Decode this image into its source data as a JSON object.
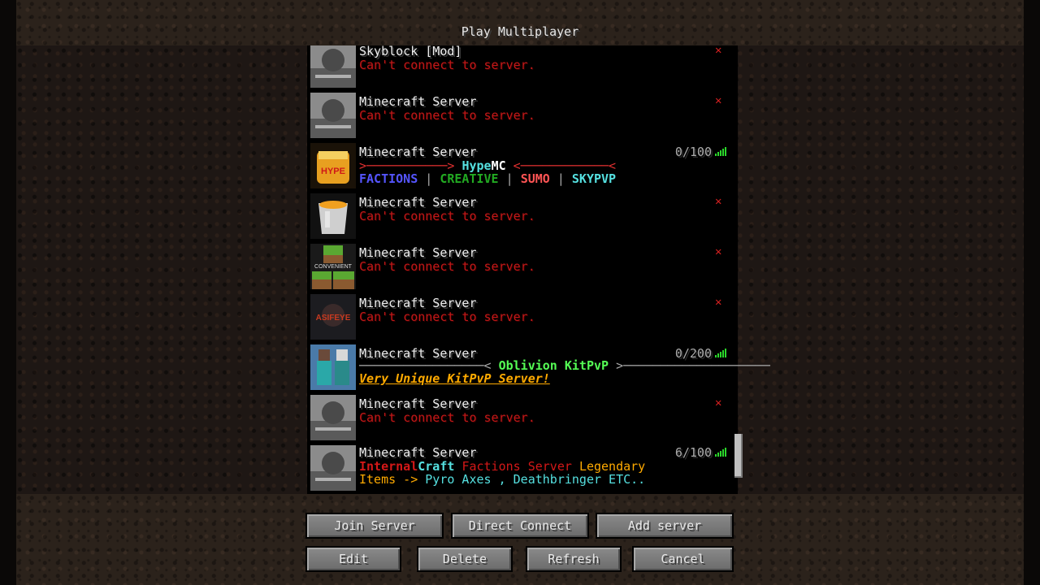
{
  "window": {
    "title": "Play Multiplayer"
  },
  "servers": [
    {
      "name": "Skyblock [Mod]",
      "status": "Can't connect to server.",
      "icon": "stone-pack-icon"
    },
    {
      "name": "Minecraft Server",
      "status": "Can't connect to server.",
      "icon": "stone-pack-icon"
    },
    {
      "name": "Minecraft Server",
      "players": "0/100",
      "icon": "hypemc-bucket-icon",
      "motd1": {
        "left": ">───────────>",
        "brand1": "Hype",
        "brand2": "MC",
        "right": "<────────────<"
      },
      "motd2": [
        "FACTIONS",
        "|",
        "CREATIVE",
        "|",
        "SUMO",
        "|",
        "SKYPVP"
      ]
    },
    {
      "name": "Minecraft Server",
      "status": "Can't connect to server.",
      "icon": "bucket-icon"
    },
    {
      "name": "Minecraft Server",
      "status": "Can't connect to server.",
      "icon": "grass-block-icon",
      "icon_text": "CONVENIENT"
    },
    {
      "name": "Minecraft Server",
      "status": "Can't connect to server.",
      "icon": "asifeye-icon",
      "icon_text": "ASIFEYE"
    },
    {
      "name": "Minecraft Server",
      "players": "0/200",
      "icon": "players-icon",
      "motd1": {
        "line_left": "─────────────────<",
        "title": "Oblivion KitPvP",
        "line_right": ">────────────────────"
      },
      "motd2": "Very Unique KitPvP Server!"
    },
    {
      "name": "Minecraft Server",
      "status": "Can't connect to server.",
      "icon": "stone-pack-icon"
    },
    {
      "name": "Minecraft Server",
      "players": "6/100",
      "icon": "stone-pack-icon",
      "motd1": {
        "a": "Internal",
        "b": "Craft",
        "c": "Factions Server",
        "d": "Legendary"
      },
      "motd2": {
        "a": "Items -> ",
        "b": "Pyro Axes , Deathbringer ETC.."
      }
    }
  ],
  "buttons": {
    "join": "Join Server",
    "direct": "Direct Connect",
    "add": "Add server",
    "edit": "Edit",
    "delete": "Delete",
    "refresh": "Refresh",
    "cancel": "Cancel"
  },
  "colors": {
    "error": "#c01818",
    "ping": "#2bd92b",
    "button": "#7a7a7a"
  }
}
